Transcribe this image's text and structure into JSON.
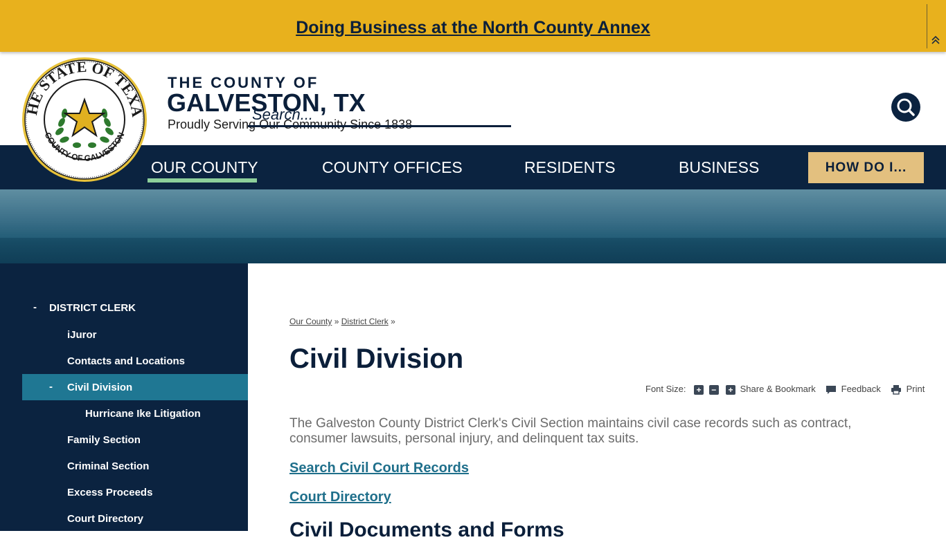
{
  "alert": {
    "link_text": "Doing Business at the North County Annex"
  },
  "header": {
    "seal_top_text": "THE STATE OF TEXAS",
    "seal_bottom_text": "COUNTY OF GALVESTON",
    "county_of": "THE COUNTY OF",
    "county_name": "GALVESTON, TX",
    "tagline": "Proudly Serving Our Community Since 1838",
    "search_placeholder": "Search..."
  },
  "nav": {
    "items": [
      {
        "label": "OUR COUNTY"
      },
      {
        "label": "COUNTY OFFICES"
      },
      {
        "label": "RESIDENTS"
      },
      {
        "label": "BUSINESS"
      }
    ],
    "how_do_i": "HOW DO I..."
  },
  "sidebar": {
    "items": [
      {
        "label": "DISTRICT CLERK",
        "prefix": "-"
      },
      {
        "label": "iJuror"
      },
      {
        "label": "Contacts and Locations"
      },
      {
        "label": "Civil Division",
        "prefix": "-"
      },
      {
        "label": "Hurricane Ike Litigation"
      },
      {
        "label": "Family Section"
      },
      {
        "label": "Criminal Section"
      },
      {
        "label": "Excess Proceeds"
      },
      {
        "label": "Court Directory"
      }
    ]
  },
  "breadcrumb": {
    "items": [
      "Our County",
      "District Clerk"
    ],
    "separator": "»"
  },
  "main": {
    "title": "Civil Division",
    "intro": "The Galveston County District Clerk's Civil Section maintains civil case records such as contract, consumer lawsuits, personal injury, and delinquent tax suits.",
    "links": [
      "Search Civil Court Records",
      "Court Directory"
    ],
    "section_heading": "Civil Documents and Forms"
  },
  "toolbar": {
    "font_size_label": "Font Size:",
    "increase": "+",
    "decrease": "−",
    "share_label": "Share & Bookmark",
    "feedback_label": "Feedback",
    "print_label": "Print"
  },
  "colors": {
    "alert_bg": "#e8b11d",
    "navy": "#0b2340",
    "active_nav_underline": "#8dcf9a",
    "how_do_i_bg": "#e3c07f",
    "sidebar_active": "#1f7793",
    "link": "#1f6f8b"
  },
  "icons": {
    "search_button": "search-icon",
    "alert_collapse": "chevron-double-up-icon",
    "feedback": "comment-icon",
    "print": "printer-icon"
  }
}
